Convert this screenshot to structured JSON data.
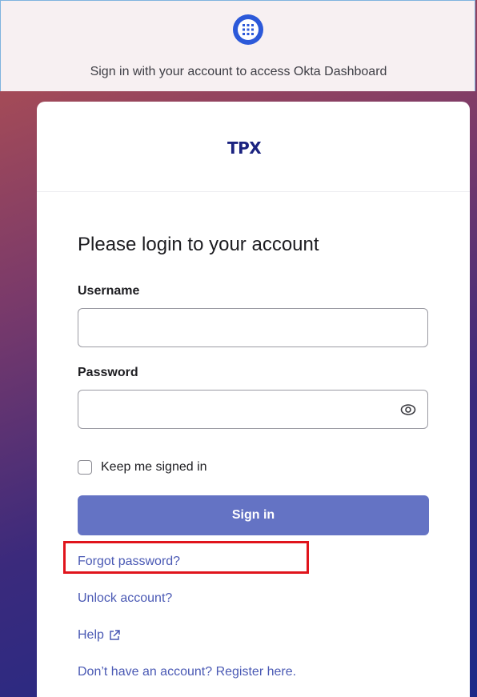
{
  "header": {
    "subtitle": "Sign in with your account to access Okta Dashboard",
    "icon": "apps-grid-icon"
  },
  "card": {
    "brand": "TPX",
    "title": "Please login to your account",
    "username": {
      "label": "Username",
      "value": "",
      "placeholder": ""
    },
    "password": {
      "label": "Password",
      "value": "",
      "placeholder": ""
    },
    "remember_label": "Keep me signed in",
    "remember_checked": false,
    "signin_label": "Sign in",
    "links": {
      "forgot": "Forgot password?",
      "unlock": "Unlock account?",
      "help": "Help",
      "register": "Don’t have an account? Register here."
    }
  },
  "colors": {
    "accent_button": "#6473c4",
    "link": "#4a59b4",
    "icon_blue": "#2c59d9",
    "highlight": "#e0141c"
  }
}
